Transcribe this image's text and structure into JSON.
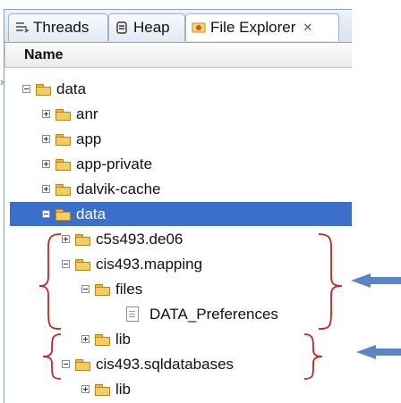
{
  "tabs": [
    {
      "label": "Threads",
      "icon": "threads-icon"
    },
    {
      "label": "Heap",
      "icon": "heap-icon"
    },
    {
      "label": "File Explorer",
      "icon": "file-explorer-icon"
    }
  ],
  "header": {
    "name_col": "Name"
  },
  "tree": [
    {
      "label": "data",
      "depth": 0,
      "state": "expanded"
    },
    {
      "label": "anr",
      "depth": 1,
      "state": "collapsed"
    },
    {
      "label": "app",
      "depth": 1,
      "state": "collapsed"
    },
    {
      "label": "app-private",
      "depth": 1,
      "state": "collapsed"
    },
    {
      "label": "dalvik-cache",
      "depth": 1,
      "state": "collapsed"
    },
    {
      "label": "data",
      "depth": 1,
      "state": "expanded",
      "selected": true
    },
    {
      "label": "c5s493.de06",
      "depth": 2,
      "state": "collapsed"
    },
    {
      "label": "cis493.mapping",
      "depth": 2,
      "state": "expanded"
    },
    {
      "label": "files",
      "depth": 3,
      "state": "expanded"
    },
    {
      "label": "DATA_Preferences",
      "depth": 4,
      "state": "file"
    },
    {
      "label": "lib",
      "depth": 3,
      "state": "collapsed"
    },
    {
      "label": "cis493.sqldatabases",
      "depth": 2,
      "state": "expanded"
    },
    {
      "label": "lib",
      "depth": 3,
      "state": "collapsed"
    }
  ],
  "colors": {
    "selection": "#3a6fcb",
    "annotation_red": "#cc2222",
    "arrow_blue": "#5b86c2"
  }
}
